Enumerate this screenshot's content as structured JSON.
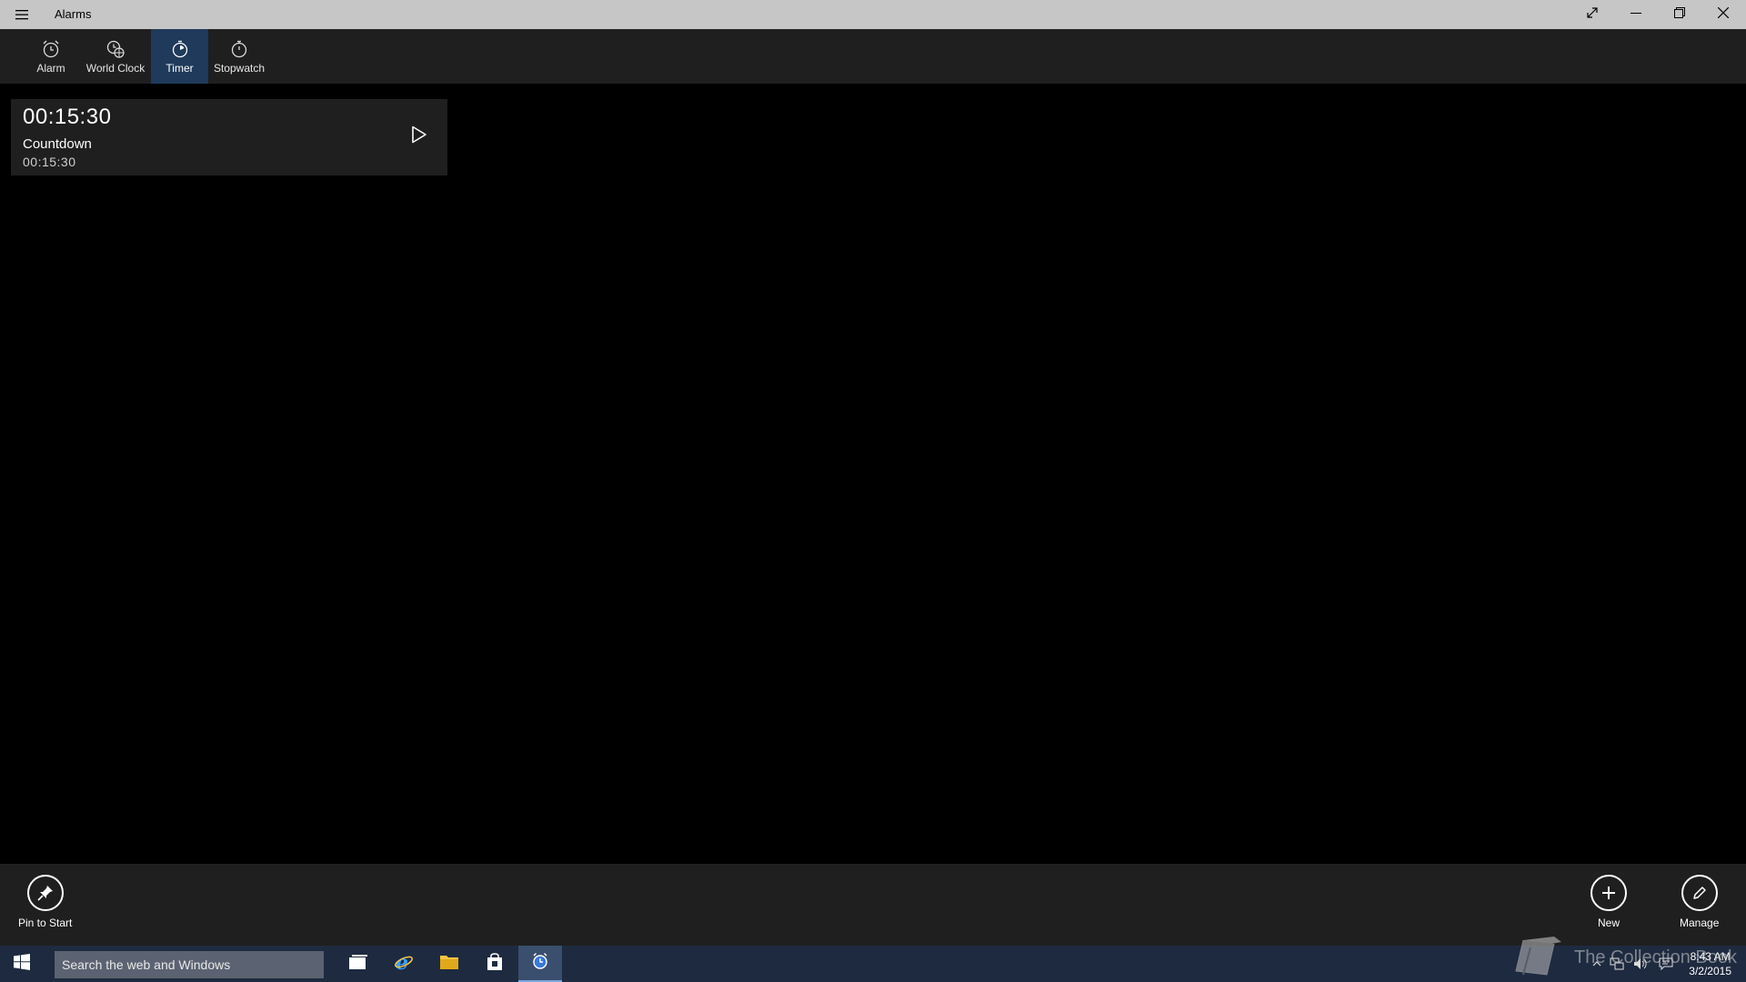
{
  "window": {
    "title": "Alarms"
  },
  "tabs": [
    {
      "label": "Alarm",
      "icon": "alarm-clock-icon",
      "active": false
    },
    {
      "label": "World Clock",
      "icon": "world-clock-icon",
      "active": false
    },
    {
      "label": "Timer",
      "icon": "timer-icon",
      "active": true
    },
    {
      "label": "Stopwatch",
      "icon": "stopwatch-icon",
      "active": false
    }
  ],
  "timers": [
    {
      "time": "00:15:30",
      "name": "Countdown",
      "duration": "00:15:30"
    }
  ],
  "commands": {
    "pin_label": "Pin to Start",
    "new_label": "New",
    "manage_label": "Manage"
  },
  "taskbar": {
    "search_placeholder": "Search the web and Windows",
    "time": "8:43 AM",
    "date": "3/2/2015"
  },
  "watermark": {
    "text": "The Collection Book"
  },
  "colors": {
    "titlebar": "#c6c6c6",
    "tabbar": "#1f1f1f",
    "active_tab": "#1f3a5a",
    "taskbar": "#1e2a3f",
    "accent": "#3a78d6"
  }
}
